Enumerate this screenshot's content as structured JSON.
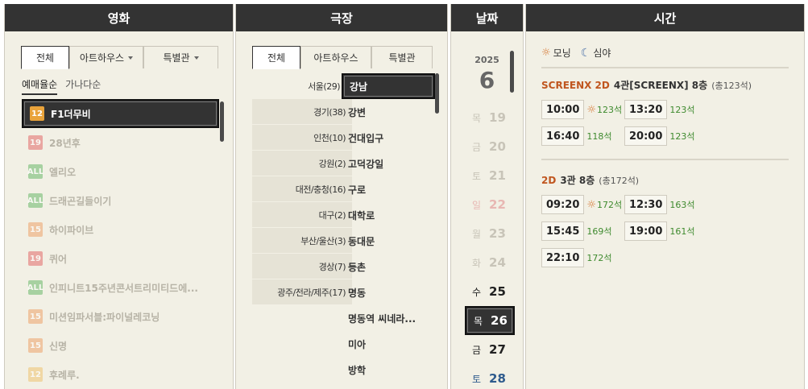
{
  "columns": {
    "movie": "영화",
    "theater": "극장",
    "date": "날짜",
    "time": "시간"
  },
  "movie_tabs": [
    {
      "label": "전체",
      "active": true,
      "dropdown": false
    },
    {
      "label": "아트하우스",
      "active": false,
      "dropdown": true
    },
    {
      "label": "특별관",
      "active": false,
      "dropdown": true
    }
  ],
  "sort": {
    "option1": "예매율순",
    "option2": "가나다순"
  },
  "movies": [
    {
      "rating": "12",
      "rating_color": "#e9a33b",
      "title": "F1더무비",
      "selected": true
    },
    {
      "rating": "19",
      "rating_color": "#e26a6a",
      "title": "28년후",
      "selected": false
    },
    {
      "rating": "ALL",
      "rating_color": "#6bb86b",
      "title": "엘리오",
      "selected": false
    },
    {
      "rating": "ALL",
      "rating_color": "#6bb86b",
      "title": "드래곤길들이기",
      "selected": false
    },
    {
      "rating": "15",
      "rating_color": "#eea36b",
      "title": "하이파이브",
      "selected": false
    },
    {
      "rating": "19",
      "rating_color": "#e26a6a",
      "title": "퀴어",
      "selected": false
    },
    {
      "rating": "ALL",
      "rating_color": "#6bb86b",
      "title": "인피니트15주년콘서트리미티드에...",
      "selected": false
    },
    {
      "rating": "15",
      "rating_color": "#eea36b",
      "title": "미션임파서블:파이널레코닝",
      "selected": false
    },
    {
      "rating": "15",
      "rating_color": "#eea36b",
      "title": "신명",
      "selected": false
    },
    {
      "rating": "12",
      "rating_color": "#f0c470",
      "title": "후례루.",
      "selected": false
    }
  ],
  "theater_tabs": [
    {
      "label": "전체",
      "active": true
    },
    {
      "label": "아트하우스",
      "active": false
    },
    {
      "label": "특별관",
      "active": false
    }
  ],
  "regions": [
    {
      "label": "서울(29)",
      "selected": true
    },
    {
      "label": "경기(38)",
      "selected": false
    },
    {
      "label": "인천(10)",
      "selected": false
    },
    {
      "label": "강원(2)",
      "selected": false
    },
    {
      "label": "대전/충청(16)",
      "selected": false
    },
    {
      "label": "대구(2)",
      "selected": false
    },
    {
      "label": "부산/울산(3)",
      "selected": false
    },
    {
      "label": "경상(7)",
      "selected": false
    },
    {
      "label": "광주/전라/제주(17)",
      "selected": false
    }
  ],
  "branches": [
    {
      "label": "강남",
      "selected": true
    },
    {
      "label": "강변",
      "selected": false
    },
    {
      "label": "건대입구",
      "selected": false
    },
    {
      "label": "고덕강일",
      "selected": false
    },
    {
      "label": "구로",
      "selected": false
    },
    {
      "label": "대학로",
      "selected": false
    },
    {
      "label": "동대문",
      "selected": false
    },
    {
      "label": "등촌",
      "selected": false
    },
    {
      "label": "명동",
      "selected": false
    },
    {
      "label": "명동역 씨네라...",
      "selected": false
    },
    {
      "label": "미아",
      "selected": false
    },
    {
      "label": "방학",
      "selected": false
    }
  ],
  "date_header": {
    "year": "2025",
    "month": "6"
  },
  "dates": [
    {
      "weekday": "목",
      "day": "19",
      "state": "dim"
    },
    {
      "weekday": "금",
      "day": "20",
      "state": "dim"
    },
    {
      "weekday": "토",
      "day": "21",
      "state": "dim"
    },
    {
      "weekday": "일",
      "day": "22",
      "state": "dim-sun"
    },
    {
      "weekday": "월",
      "day": "23",
      "state": "dim"
    },
    {
      "weekday": "화",
      "day": "24",
      "state": "dim"
    },
    {
      "weekday": "수",
      "day": "25",
      "state": "on"
    },
    {
      "weekday": "목",
      "day": "26",
      "state": "selected"
    },
    {
      "weekday": "금",
      "day": "27",
      "state": "on"
    },
    {
      "weekday": "토",
      "day": "28",
      "state": "on-sat"
    }
  ],
  "legend": {
    "morning": "모닝",
    "late_night": "심야"
  },
  "screens": [
    {
      "type": "SCREENX 2D",
      "hall": "4관[SCREENX] 8층",
      "total": "(총123석)",
      "times": [
        {
          "time": "10:00",
          "seats": "123석",
          "morning": true
        },
        {
          "time": "13:20",
          "seats": "123석",
          "morning": false
        },
        {
          "time": "16:40",
          "seats": "118석",
          "morning": false
        },
        {
          "time": "20:00",
          "seats": "123석",
          "morning": false
        }
      ]
    },
    {
      "type": "2D",
      "hall": "3관 8층",
      "total": "(총172석)",
      "times": [
        {
          "time": "09:20",
          "seats": "172석",
          "morning": true
        },
        {
          "time": "12:30",
          "seats": "163석",
          "morning": false
        },
        {
          "time": "15:45",
          "seats": "169석",
          "morning": false
        },
        {
          "time": "19:00",
          "seats": "161석",
          "morning": false
        },
        {
          "time": "22:10",
          "seats": "172석",
          "morning": false
        }
      ]
    }
  ],
  "colors": {
    "header_bg": "#333333",
    "panel_bg": "#f2f0e5",
    "screen_type": "#c0561f",
    "seats_green": "#3e8a2e",
    "saturday_blue": "#2f5b8d"
  }
}
